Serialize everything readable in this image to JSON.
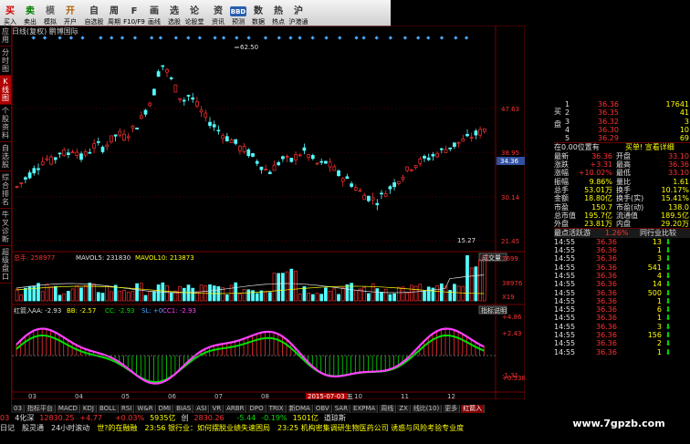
{
  "toolbar": [
    {
      "id": "buy",
      "label": "买入",
      "icon": "买",
      "color": "#d00000"
    },
    {
      "id": "sell",
      "label": "卖出",
      "icon": "卖",
      "color": "#008000"
    },
    {
      "id": "sim",
      "label": "模拟",
      "icon": "模",
      "color": "#666"
    },
    {
      "id": "open",
      "label": "开户",
      "icon": "开",
      "color": "#b06000"
    },
    {
      "id": "watch",
      "label": "自选股",
      "icon": "自",
      "color": "#333"
    },
    {
      "id": "period",
      "label": "周期",
      "icon": "周",
      "color": "#333"
    },
    {
      "id": "f10",
      "label": "F10/F9",
      "icon": "F",
      "color": "#333"
    },
    {
      "id": "draw",
      "label": "画线",
      "icon": "画",
      "color": "#333"
    },
    {
      "id": "pick",
      "label": "选股",
      "icon": "选",
      "color": "#333"
    },
    {
      "id": "forum",
      "label": "论股堂",
      "icon": "论",
      "color": "#333"
    },
    {
      "id": "news",
      "label": "资讯",
      "icon": "资",
      "color": "#333"
    },
    {
      "id": "bbd",
      "label": "",
      "icon": "BBD",
      "color": "#fff"
    },
    {
      "id": "data",
      "label": "数据",
      "icon": "数",
      "color": "#333"
    },
    {
      "id": "hot",
      "label": "热点",
      "icon": "热",
      "color": "#333"
    },
    {
      "id": "hk",
      "label": "沪港通",
      "icon": "沪",
      "color": "#333"
    }
  ],
  "toolbar_extra": {
    "bbd_sub": "预测"
  },
  "left_tabs": [
    "应用",
    "分时图",
    "K线图",
    "个股资料",
    "自选股",
    "综合排名",
    "牛叉诊断",
    "超级盘口"
  ],
  "chart_title": "日线(复权) 鹏博国际",
  "price_labels": [
    "47.63",
    "38.95",
    "30.14",
    "21.45"
  ],
  "high_label": "62.50",
  "low_label": "15.27",
  "current_price_tag": "34.36",
  "volume_panel": {
    "title": "总手: 258977",
    "ma5": "MAVOL5: 231830",
    "ma10": "MAVOL10: 213873",
    "button": "成交量",
    "scale": [
      "7699",
      "38976",
      "X19"
    ]
  },
  "indicator_panel": {
    "title": "红箭入",
    "aa": "AA: -2.93",
    "bb": "BB: -2.57",
    "cc": "CC: -2.93",
    "sl": "SL: +0",
    "cc1": "CC1: -2.93",
    "button": "指标说明",
    "scale": [
      "+4.86",
      "+2.43",
      "+0.538",
      "-1.31"
    ]
  },
  "dates": [
    "03",
    "04",
    "05",
    "06",
    "07",
    "08",
    "09",
    "10",
    "11",
    "12"
  ],
  "date_highlight": "2015-07-03 五",
  "quote": {
    "side_label": "买 盘",
    "bids": [
      [
        "1",
        "36.36",
        "17641"
      ],
      [
        "2",
        "36.35",
        "41"
      ],
      [
        "3",
        "36.32",
        "3"
      ],
      [
        "4",
        "36.30",
        "10"
      ],
      [
        "5",
        "36.29",
        "69"
      ]
    ],
    "position": "在0.00位置有",
    "buy_price": "买单! 宣看详细",
    "stats": [
      [
        "最新",
        "36.36",
        "开盘",
        "33.10"
      ],
      [
        "涨跌",
        "+3.31",
        "最高",
        "36.36"
      ],
      [
        "涨幅",
        "+10.02%",
        "最低",
        "33.10"
      ],
      [
        "振幅",
        "9.86%",
        "量比",
        "1.61"
      ],
      [
        "总手",
        "53.01万",
        "换手",
        "10.17%"
      ],
      [
        "金额",
        "18.80亿",
        "换手(实)",
        "15.41%"
      ],
      [
        "市盈",
        "150.7",
        "市盈(动)",
        "138.0"
      ],
      [
        "总市值",
        "195.7亿",
        "流通值",
        "189.5亿"
      ],
      [
        "外盘",
        "23.81万",
        "内盘",
        "29.20万"
      ]
    ],
    "trade_tabs": [
      "最点活跃游",
      "1.26%",
      "同行业比较"
    ],
    "ticks": [
      [
        "14:55",
        "36.36",
        "13"
      ],
      [
        "14:55",
        "36.36",
        "1"
      ],
      [
        "14:55",
        "36.36",
        "3"
      ],
      [
        "14:55",
        "36.36",
        "541"
      ],
      [
        "14:55",
        "36.36",
        "4"
      ],
      [
        "14:55",
        "36.36",
        "14"
      ],
      [
        "14:55",
        "36.36",
        "500"
      ],
      [
        "14:55",
        "36.36",
        "1"
      ],
      [
        "14:55",
        "36.36",
        "6"
      ],
      [
        "14:55",
        "36.36",
        "1"
      ],
      [
        "14:55",
        "36.36",
        "3"
      ],
      [
        "14:55",
        "36.36",
        "156"
      ],
      [
        "14:55",
        "36.36",
        "2"
      ],
      [
        "14:55",
        "36.36",
        "1"
      ]
    ]
  },
  "bottom_tabs": [
    "03",
    "指标平台",
    "MACD",
    "KDJ",
    "BOLL",
    "RSI",
    "W&R",
    "DMI",
    "BIAS",
    "ASI",
    "VR",
    "ARBR",
    "DPO",
    "TRIX",
    "新DMA",
    "OBV",
    "SAR",
    "EXPMA",
    "周线",
    "ZX",
    "线比(10)",
    "更多",
    "红箭入"
  ],
  "status1": [
    {
      "t": "03",
      "c": "#ff3030"
    },
    {
      "t": "4化深",
      "c": "#e0e0e0"
    },
    {
      "t": "12830.25",
      "c": "#ff3030"
    },
    {
      "t": "+4.77",
      "c": "#ff3030"
    },
    {
      "t": "+0.03%",
      "c": "#ff3030"
    },
    {
      "t": "5935亿",
      "c": "#ffff00"
    },
    {
      "t": "创",
      "c": "#e0e0e0"
    },
    {
      "t": "2830.26",
      "c": "#ff3030"
    },
    {
      "t": "-5.44",
      "c": "#00e000"
    },
    {
      "t": "-0.19%",
      "c": "#00e000"
    },
    {
      "t": "1501亿",
      "c": "#ffff00"
    },
    {
      "t": "道琼斯",
      "c": "#e0e0e0"
    }
  ],
  "status2": [
    {
      "t": "日记",
      "c": "#e0e0e0"
    },
    {
      "t": "股灵通",
      "c": "#e0e0e0"
    },
    {
      "t": "24小时滚动",
      "c": "#e0e0e0"
    },
    {
      "t": "世?的在融融",
      "c": "#ffff00"
    },
    {
      "t": "23:56 银行业：如何摆脱业绩失速困局",
      "c": "#ffff00"
    },
    {
      "t": "23:25 机构密集调研生物医药公司 诱惑与风险考验专业度",
      "c": "#ffff00"
    }
  ],
  "watermark": "www.7gpzb.com"
}
